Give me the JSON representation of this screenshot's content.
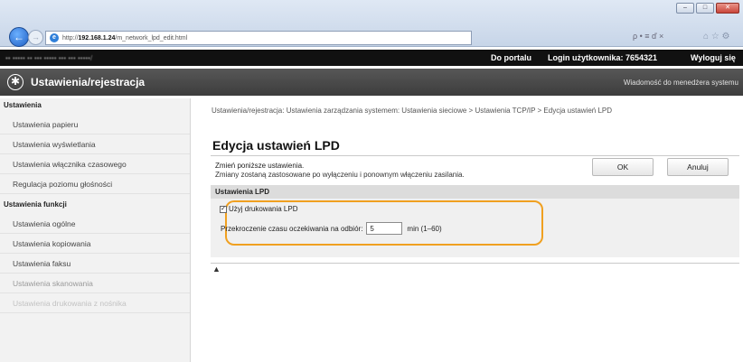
{
  "browser": {
    "url_prefix": "http://",
    "url_host": "192.168.1.24",
    "url_path": "/m_network_lpd_edit.html",
    "search_tools": "ρ • ≡ ď ×",
    "fav_tools": "⌂ ☆ ⚙",
    "back_label": "←",
    "forward_label": "→",
    "win_min": "–",
    "win_max": "□",
    "win_close": "✕"
  },
  "topbar": {
    "model": "•• •••••   •• ••• •••••  ••• ••• •••••/",
    "portal": "Do portalu",
    "login": "Login użytkownika:  7654321",
    "logout": "Wyloguj się"
  },
  "header": {
    "title": "Ustawienia/rejestracja",
    "admin": "Wiadomość do menedżera systemu"
  },
  "sidebar": {
    "group1": "Ustawienia",
    "items1": [
      "Ustawienia papieru",
      "Ustawienia wyświetlania",
      "Ustawienia włącznika czasowego",
      "Regulacja poziomu głośności"
    ],
    "group2": "Ustawienia funkcji",
    "items2": [
      "Ustawienia ogólne",
      "Ustawienia kopiowania",
      "Ustawienia faksu",
      "Ustawienia skanowania",
      "Ustawienia drukowania z nośnika"
    ]
  },
  "main": {
    "breadcrumb": "Ustawienia/rejestracja: Ustawienia zarządzania systemem: Ustawienia sieciowe > Ustawienia TCP/IP > Edycja ustawień LPD",
    "title": "Edycja ustawień LPD",
    "desc1": "Zmień poniższe ustawienia.",
    "desc2": "Zmiany zostaną zastosowane po wyłączeniu i ponownym włączeniu zasilania.",
    "ok_label": "OK",
    "cancel_label": "Anuluj",
    "section_title": "Ustawienia LPD",
    "checkbox_label": "Użyj drukowania LPD",
    "checkbox_mark": "✓",
    "timeout_label": "Przekroczenie czasu oczekiwania na odbiór:",
    "timeout_value": "5",
    "timeout_unit": "min (1–60)",
    "top_icon": "▲"
  }
}
